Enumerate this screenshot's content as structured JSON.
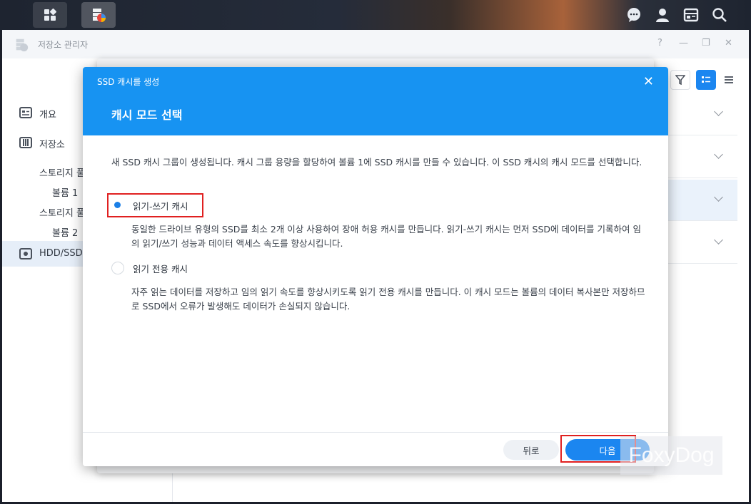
{
  "window": {
    "title": "저장소 관리자",
    "controls": [
      "?",
      "—",
      "❐",
      "✕"
    ]
  },
  "sidebar": {
    "items": [
      {
        "label": "개요",
        "icon": "overview-icon"
      },
      {
        "label": "저장소",
        "icon": "storage-icon"
      },
      {
        "label": "스토리지 풀",
        "icon": ""
      },
      {
        "label": "볼륨 1",
        "icon": ""
      },
      {
        "label": "스토리지 풀",
        "icon": ""
      },
      {
        "label": "볼륨 2",
        "icon": ""
      },
      {
        "label": "HDD/SSD",
        "icon": "drive-icon"
      }
    ]
  },
  "modal": {
    "subtitle": "SSD 캐시를 생성",
    "title": "캐시 모드 선택",
    "description": "새 SSD 캐시 그룹이 생성됩니다. 캐시 그룹 용량을 할당하여 볼륨 1에 SSD 캐시를 만들 수 있습니다. 이 SSD 캐시의 캐시 모드를 선택합니다.",
    "options": [
      {
        "label": "읽기-쓰기 캐시",
        "selected": true,
        "description": "동일한 드라이브 유형의 SSD를 최소 2개 이상 사용하여 장애 허용 캐시를 만듭니다. 읽기-쓰기 캐시는 먼저 SSD에 데이터를 기록하여 임의 읽기/쓰기 성능과 데이터 액세스 속도를 향상시킵니다."
      },
      {
        "label": "읽기 전용 캐시",
        "selected": false,
        "description": "자주 읽는 데이터를 저장하고 임의 읽기 속도를 향상시키도록 읽기 전용 캐시를 만듭니다. 이 캐시 모드는 볼륨의 데이터 복사본만 저장하므로 SSD에서 오류가 발생해도 데이터가 손실되지 않습니다."
      }
    ],
    "buttons": {
      "back": "뒤로",
      "next": "다음"
    }
  },
  "watermark": "FoxyDog",
  "colors": {
    "accent": "#1793f2",
    "highlight": "#e02020",
    "button": "#1b86f0"
  }
}
